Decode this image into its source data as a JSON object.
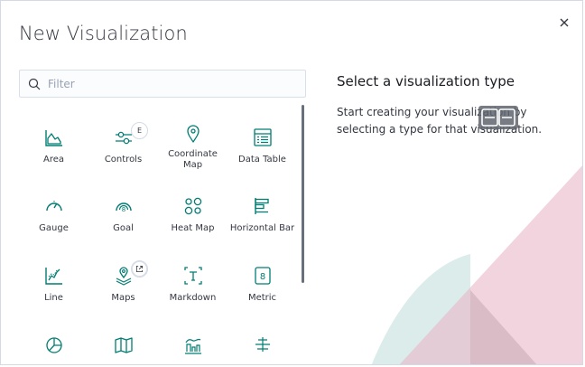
{
  "modal": {
    "title": "New Visualization",
    "close_icon": "close-icon"
  },
  "search": {
    "placeholder": "Filter",
    "value": "",
    "icon": "search-icon"
  },
  "visualizations": [
    {
      "label": "Area",
      "icon": "area-chart-icon"
    },
    {
      "label": "Controls",
      "icon": "controls-icon",
      "badge": "E"
    },
    {
      "label": "Coordinate Map",
      "icon": "map-pin-icon"
    },
    {
      "label": "Data Table",
      "icon": "table-icon"
    },
    {
      "label": "Gauge",
      "icon": "gauge-icon"
    },
    {
      "label": "Goal",
      "icon": "goal-icon"
    },
    {
      "label": "Heat Map",
      "icon": "heat-map-icon"
    },
    {
      "label": "Horizontal Bar",
      "icon": "horizontal-bar-icon"
    },
    {
      "label": "Line",
      "icon": "line-chart-icon"
    },
    {
      "label": "Maps",
      "icon": "maps-icon",
      "badge_icon": "external-link-icon"
    },
    {
      "label": "Markdown",
      "icon": "markdown-icon"
    },
    {
      "label": "Metric",
      "icon": "metric-icon"
    },
    {
      "label": "",
      "icon": "pie-chart-icon"
    },
    {
      "label": "",
      "icon": "region-map-icon"
    },
    {
      "label": "",
      "icon": "tsvb-icon"
    },
    {
      "label": "",
      "icon": "tag-cloud-icon"
    }
  ],
  "description": {
    "title": "Select a visualization type",
    "text": "Start creating your visualization by selecting a type for that visualization."
  },
  "colors": {
    "accent": "#017d73",
    "text": "#343741",
    "border": "#d3dae6",
    "deco_pink": "#e8b7c6",
    "deco_teal": "#cfe6e3"
  }
}
